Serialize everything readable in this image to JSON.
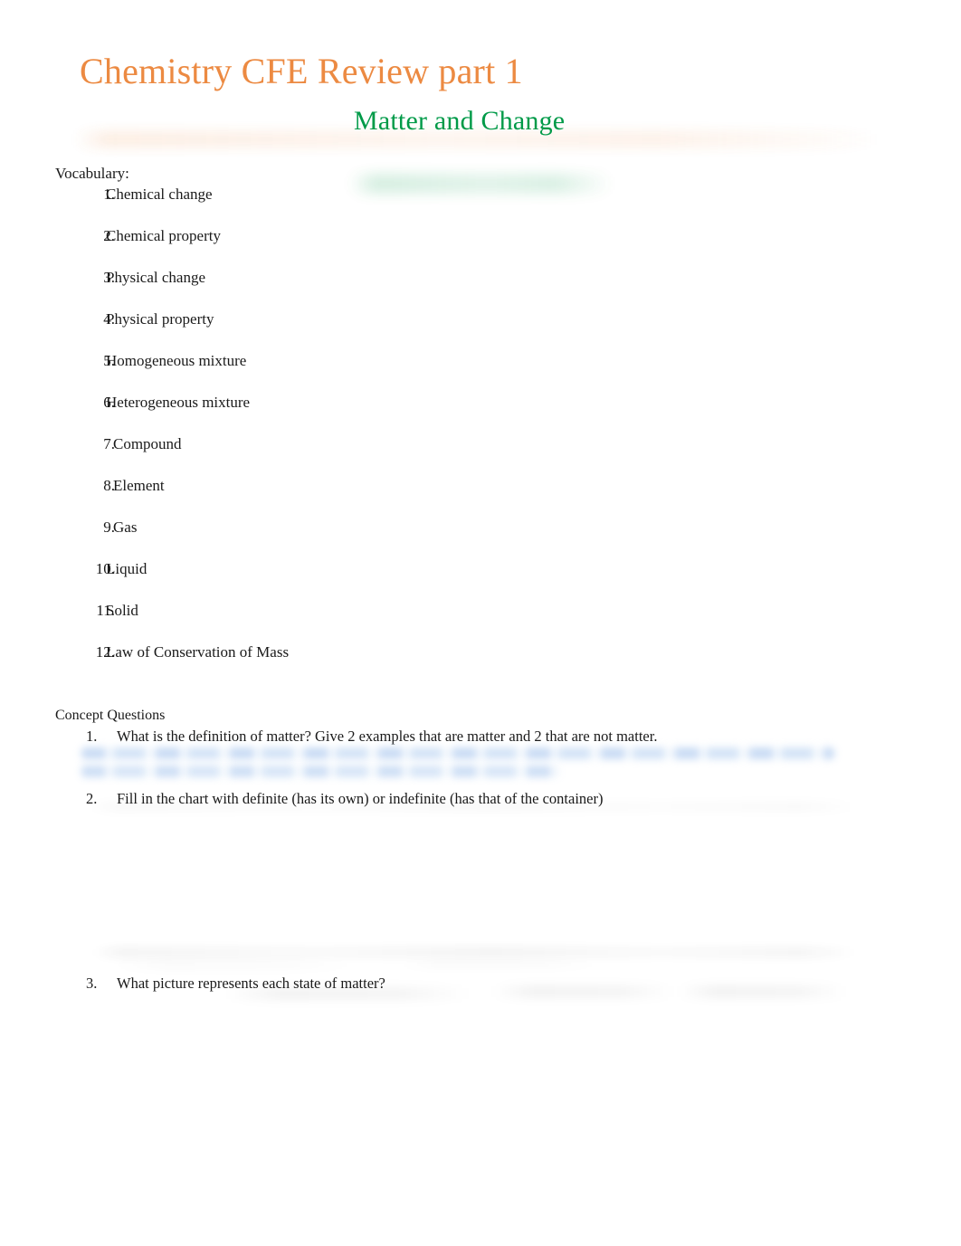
{
  "document": {
    "title": "Chemistry CFE Review part 1",
    "subtitle": "Matter and Change",
    "title_color": "#ec8a42",
    "subtitle_color": "#009a48"
  },
  "vocabulary": {
    "heading": "Vocabulary:",
    "items": [
      {
        "num": "1.",
        "label": "Chemical  change"
      },
      {
        "num": "2.",
        "label": "Chemical  property"
      },
      {
        "num": "3.",
        "label": "Physical  change"
      },
      {
        "num": "4.",
        "label": "Physical  property"
      },
      {
        "num": "5.",
        "label": "Homogeneous  mixture"
      },
      {
        "num": "6.",
        "label": "Heterogeneous  mixture"
      },
      {
        "num": "7.",
        "label": "Compound"
      },
      {
        "num": "8.",
        "label": "Element"
      },
      {
        "num": "9.",
        "label": "Gas"
      },
      {
        "num": "10.",
        "label": "Liquid"
      },
      {
        "num": "11.",
        "label": "Solid"
      },
      {
        "num": "12.",
        "label": "Law of Conservation of Mass"
      }
    ]
  },
  "concept_questions": {
    "heading": "Concept Questions",
    "items": [
      {
        "num": "1.",
        "text": "What is the definition of matter? Give 2 examples that are matter and 2 that are not matter."
      },
      {
        "num": "2.",
        "text": "Fill in the chart with definite (has its own) or indefinite (has that of the container)"
      },
      {
        "num": "3.",
        "text": "What picture represents each state of matter?"
      }
    ]
  }
}
